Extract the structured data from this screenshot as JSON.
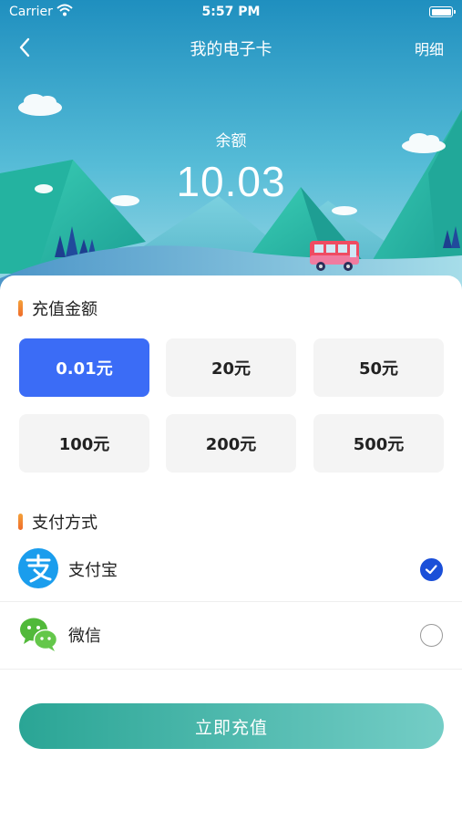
{
  "status_bar": {
    "carrier": "Carrier",
    "time": "5:57 PM"
  },
  "nav": {
    "title": "我的电子卡",
    "detail_label": "明细"
  },
  "balance": {
    "label": "余额",
    "value": "10.03"
  },
  "recharge": {
    "section_title": "充值金额",
    "selected_index": 0,
    "amounts": [
      "0.01元",
      "20元",
      "50元",
      "100元",
      "200元",
      "500元"
    ]
  },
  "payment": {
    "section_title": "支付方式",
    "methods": [
      {
        "label": "支付宝",
        "icon": "alipay-icon",
        "selected": true
      },
      {
        "label": "微信",
        "icon": "wechat-icon",
        "selected": false
      }
    ]
  },
  "submit_label": "立即充值",
  "colors": {
    "accent_blue": "#3b6cf6",
    "check_blue": "#1a4fd8",
    "teal_button_start": "#2aa595",
    "teal_button_end": "#74cdc6",
    "section_bar": "#ef6b2a"
  }
}
